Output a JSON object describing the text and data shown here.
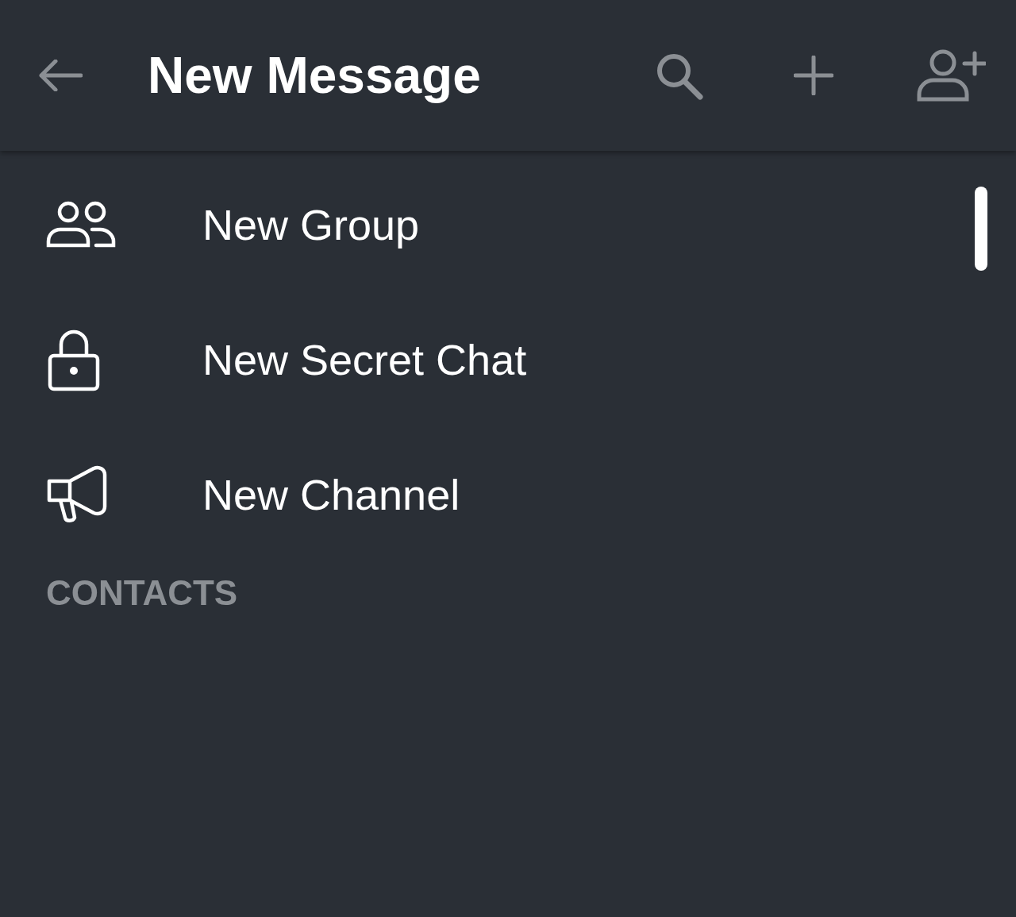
{
  "header": {
    "title": "New Message"
  },
  "items": [
    {
      "kind": "group",
      "label": "New Group"
    },
    {
      "kind": "secret",
      "label": "New Secret Chat"
    },
    {
      "kind": "channel",
      "label": "New Channel"
    }
  ],
  "section_header": "CONTACTS"
}
